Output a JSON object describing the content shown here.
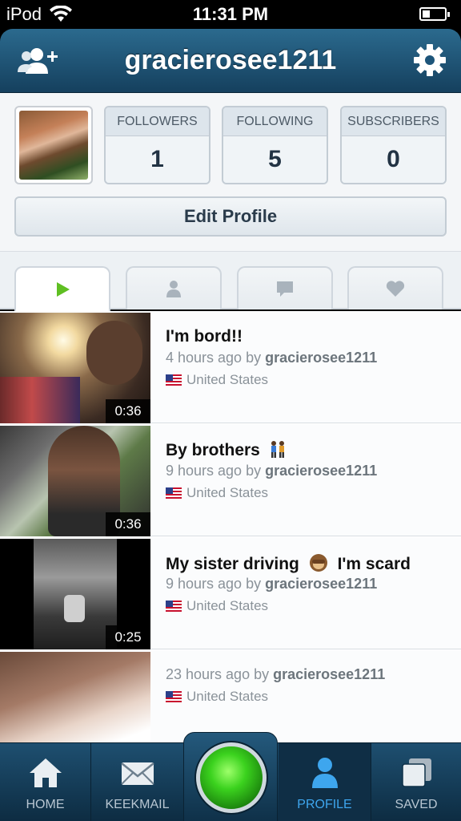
{
  "status_bar": {
    "device": "iPod",
    "time": "11:31 PM"
  },
  "header": {
    "title": "gracierosee1211",
    "add_friend_icon": "add-friend-icon",
    "settings_icon": "gear-icon"
  },
  "profile": {
    "stats": [
      {
        "label": "FOLLOWERS",
        "value": "1"
      },
      {
        "label": "FOLLOWING",
        "value": "5"
      },
      {
        "label": "SUBSCRIBERS",
        "value": "0"
      }
    ],
    "edit_profile_label": "Edit Profile"
  },
  "tabs": [
    {
      "icon": "play-icon",
      "active": true
    },
    {
      "icon": "person-icon",
      "active": false
    },
    {
      "icon": "comment-icon",
      "active": false
    },
    {
      "icon": "heart-icon",
      "active": false
    }
  ],
  "videos": [
    {
      "title": "I'm bord!!",
      "time": "4 hours ago by",
      "user": "gracierosee1211",
      "location": "United States",
      "duration": "0:36"
    },
    {
      "title": "By brothers",
      "time": "9 hours ago by",
      "user": "gracierosee1211",
      "location": "United States",
      "duration": "0:36"
    },
    {
      "title": "My sister driving",
      "title_suffix": "I'm scard",
      "time": "9 hours ago by",
      "user": "gracierosee1211",
      "location": "United States",
      "duration": "0:25"
    },
    {
      "title": "",
      "time": "23 hours ago by",
      "user": "gracierosee1211",
      "location": "United States",
      "duration": ""
    }
  ],
  "bottom_nav": {
    "home": "HOME",
    "keekmail": "KEEKMAIL",
    "profile": "PROFILE",
    "saved": "SAVED"
  },
  "colors": {
    "header": "#1d557a",
    "active_nav": "#3ea6ee",
    "record_green": "#3bd21e",
    "play_green": "#5fbf22"
  }
}
